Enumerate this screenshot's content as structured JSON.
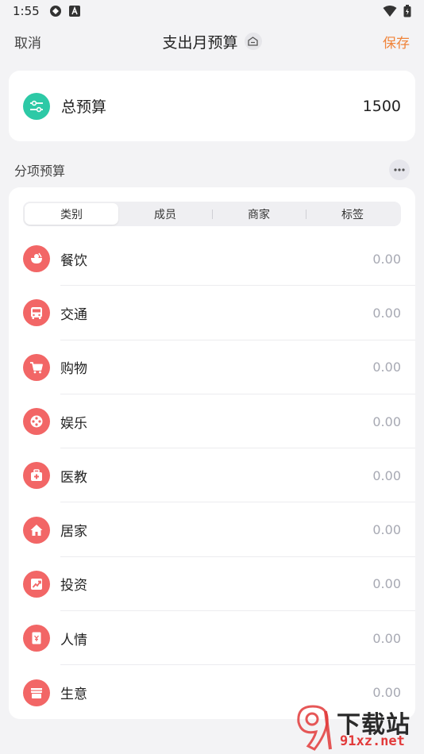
{
  "status_bar": {
    "time": "1:55"
  },
  "header": {
    "cancel": "取消",
    "title": "支出月预算",
    "save": "保存"
  },
  "total": {
    "label": "总预算",
    "value": "1500"
  },
  "section": {
    "title": "分项预算"
  },
  "tabs": [
    {
      "label": "类别",
      "active": true
    },
    {
      "label": "成员",
      "active": false
    },
    {
      "label": "商家",
      "active": false
    },
    {
      "label": "标签",
      "active": false
    }
  ],
  "categories": [
    {
      "name": "餐饮",
      "value": "0.00",
      "icon": "bowl-icon"
    },
    {
      "name": "交通",
      "value": "0.00",
      "icon": "bus-icon"
    },
    {
      "name": "购物",
      "value": "0.00",
      "icon": "cart-icon"
    },
    {
      "name": "娱乐",
      "value": "0.00",
      "icon": "film-reel-icon"
    },
    {
      "name": "医教",
      "value": "0.00",
      "icon": "medical-kit-icon"
    },
    {
      "name": "居家",
      "value": "0.00",
      "icon": "home-icon"
    },
    {
      "name": "投资",
      "value": "0.00",
      "icon": "trend-up-icon"
    },
    {
      "name": "人情",
      "value": "0.00",
      "icon": "red-envelope-icon"
    },
    {
      "name": "生意",
      "value": "0.00",
      "icon": "shop-icon"
    }
  ],
  "watermark": {
    "brand": "下载站",
    "domain": "91xz.net"
  },
  "colors": {
    "accent": "#f0843a",
    "total_icon": "#2dc9a6",
    "category_icon": "#f26666"
  }
}
